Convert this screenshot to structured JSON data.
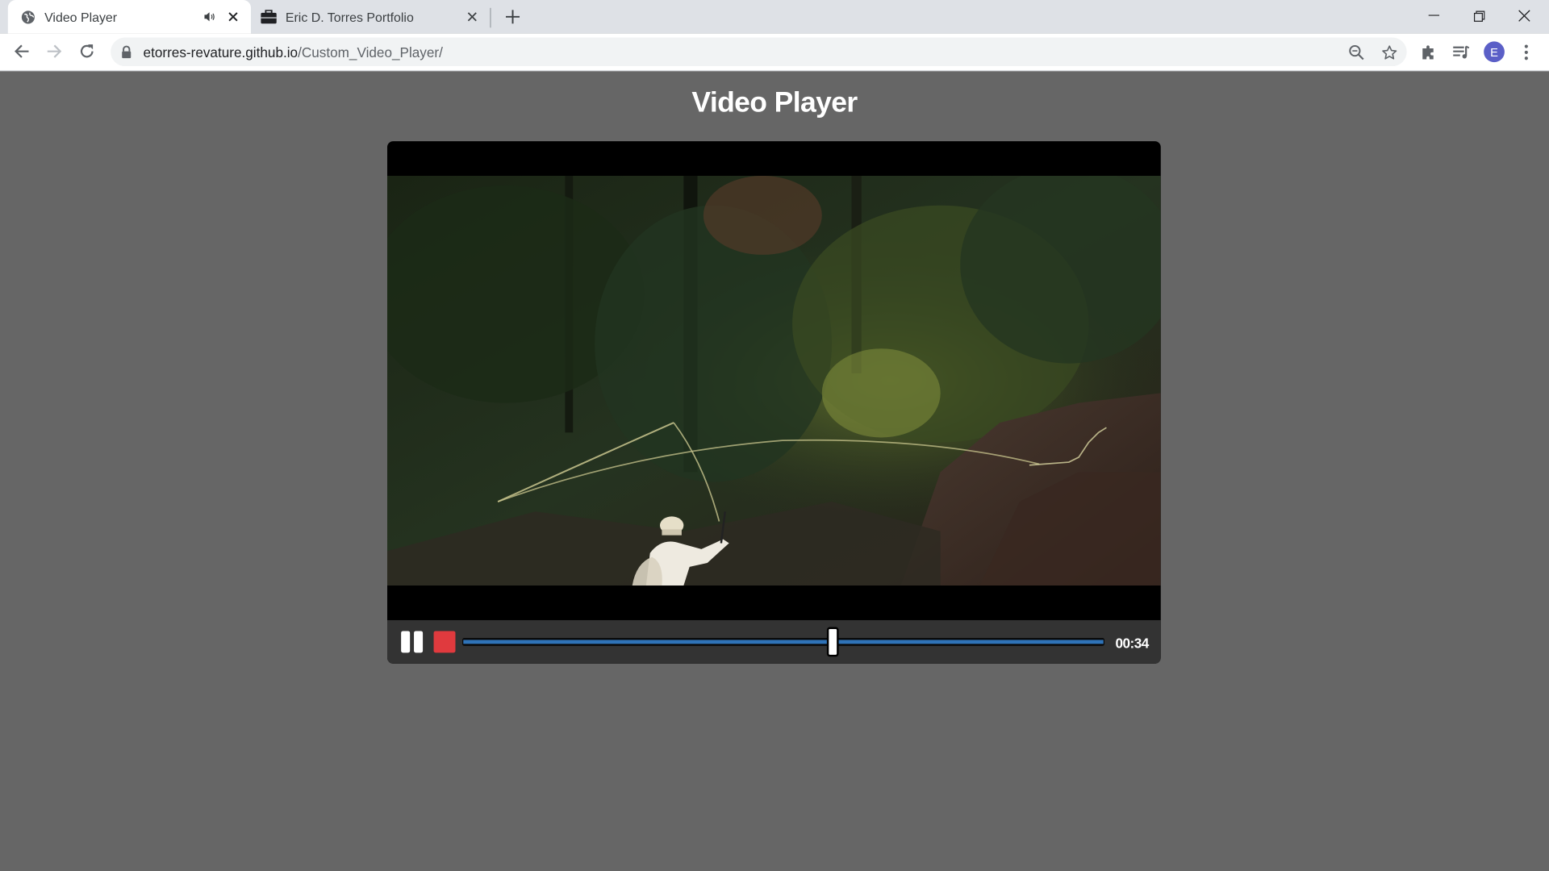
{
  "browser": {
    "tabs": [
      {
        "title": "Video Player",
        "favicon": "globe-icon",
        "muted_indicator": "speaker-icon"
      },
      {
        "title": "Eric D. Torres Portfolio",
        "favicon": "briefcase-icon"
      }
    ],
    "url": {
      "host": "etorres-revature.github.io",
      "path": "/Custom_Video_Player/"
    },
    "profile_initial": "E"
  },
  "page": {
    "heading": "Video Player",
    "background": "#666666"
  },
  "player": {
    "state": "playing",
    "time": "00:34",
    "progress_fraction": 0.577,
    "colors": {
      "stop_button": "#e03a3e",
      "progress_line": "#2f73b8",
      "controls_bar": "#333333"
    }
  }
}
